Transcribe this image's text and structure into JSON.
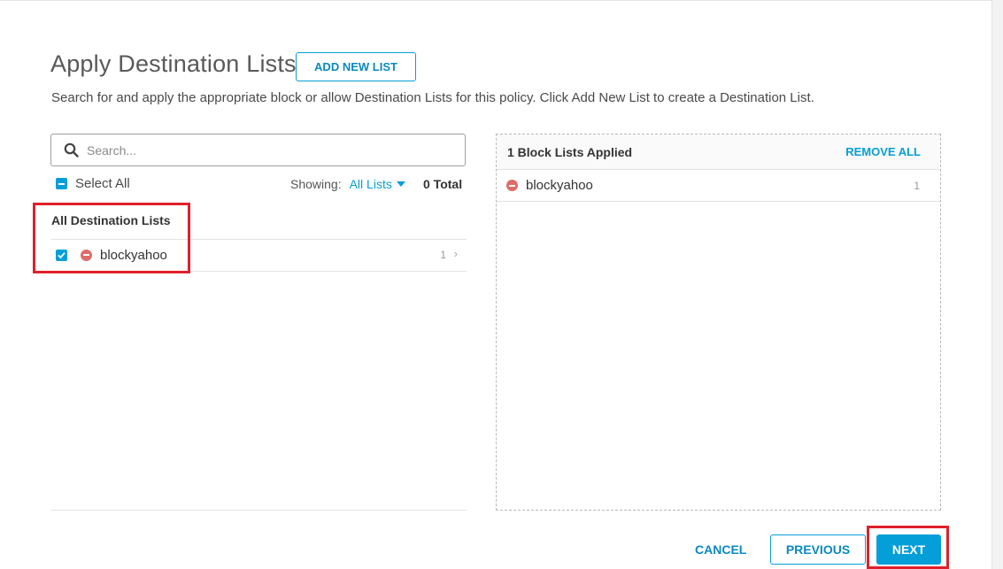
{
  "header": {
    "title": "Apply Destination Lists",
    "add_button_label": "ADD NEW LIST",
    "description": "Search for and apply the appropriate block or allow Destination Lists for this policy. Click Add New List to create a Destination List."
  },
  "search": {
    "placeholder": "Search...",
    "value": ""
  },
  "list_controls": {
    "select_all_label": "Select All",
    "showing_label": "Showing:",
    "filter_value": "All Lists",
    "total_label": "0 Total"
  },
  "available_lists": {
    "heading": "All Destination Lists",
    "items": [
      {
        "name": "blockyahoo",
        "count": "1",
        "checked": true,
        "type": "block"
      }
    ]
  },
  "applied": {
    "title": "1 Block Lists Applied",
    "remove_all_label": "REMOVE ALL",
    "items": [
      {
        "name": "blockyahoo",
        "count": "1",
        "type": "block"
      }
    ]
  },
  "footer": {
    "cancel_label": "CANCEL",
    "previous_label": "PREVIOUS",
    "next_label": "NEXT"
  },
  "colors": {
    "accent": "#049fd9",
    "block_icon": "#d9534f",
    "highlight": "#e0202a"
  },
  "icons": [
    "search-icon",
    "block-icon",
    "checkbox-checked-icon",
    "checkbox-partial-icon",
    "caret-down-icon",
    "chevron-right-icon"
  ]
}
